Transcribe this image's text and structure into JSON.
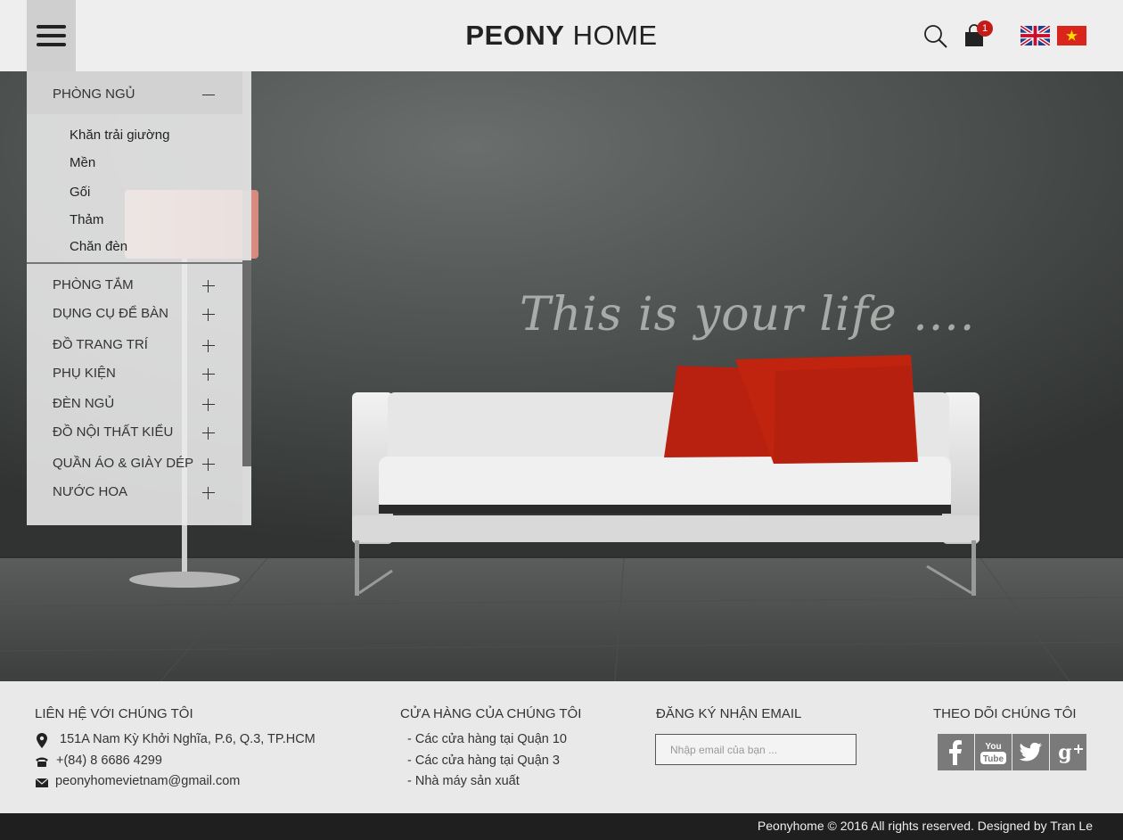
{
  "header": {
    "logo_bold": "PEONY",
    "logo_thin": "HOME",
    "cart_count": "1"
  },
  "hero": {
    "tagline": "This is your life ...."
  },
  "side_menu": {
    "open_category": "PHÒNG NGỦ",
    "sub_items": [
      "Khăn trải giường",
      "Mền",
      "Gối",
      "Thảm",
      "Chăn đèn"
    ],
    "categories": [
      "PHÒNG TẮM",
      "DỤNG CỤ ĐỂ BÀN",
      "ĐỒ TRANG TRÍ",
      "PHỤ KIỆN",
      "ĐÈN NGỦ",
      "ĐỒ NỘI THẤT KIỂU",
      "QUẦN ÁO & GIÀY DÉP",
      "NƯỚC HOA"
    ]
  },
  "footer": {
    "contact": {
      "title": "LIÊN HỆ VỚI CHÚNG TÔI",
      "address": "151A Nam Kỳ Khởi Nghĩa, P.6, Q.3, TP.HCM",
      "phone": "+(84) 8 6686 4299",
      "email": "peonyhomevietnam@gmail.com"
    },
    "stores": {
      "title": "CỬA HÀNG CỦA CHÚNG TÔI",
      "items": [
        "- Các cửa hàng tại Quận 10",
        "- Các cửa hàng tại Quận 3",
        "- Nhà máy sản xuất"
      ]
    },
    "newsletter": {
      "title": "ĐĂNG KÝ NHẬN EMAIL",
      "placeholder": "Nhập email của bạn ..."
    },
    "follow": {
      "title": "THEO DÕI CHÚNG TÔI",
      "networks": [
        "facebook-icon",
        "youtube-icon",
        "twitter-icon",
        "google-plus-icon"
      ]
    },
    "copyright": "Peonyhome © 2016 All rights reserved. Designed by Tran Le"
  },
  "colors": {
    "cart_badge": "#c41a1a",
    "cushion_red": "#b8200f",
    "wall": "#4a4d4c",
    "copybar": "#1f1f1f"
  }
}
